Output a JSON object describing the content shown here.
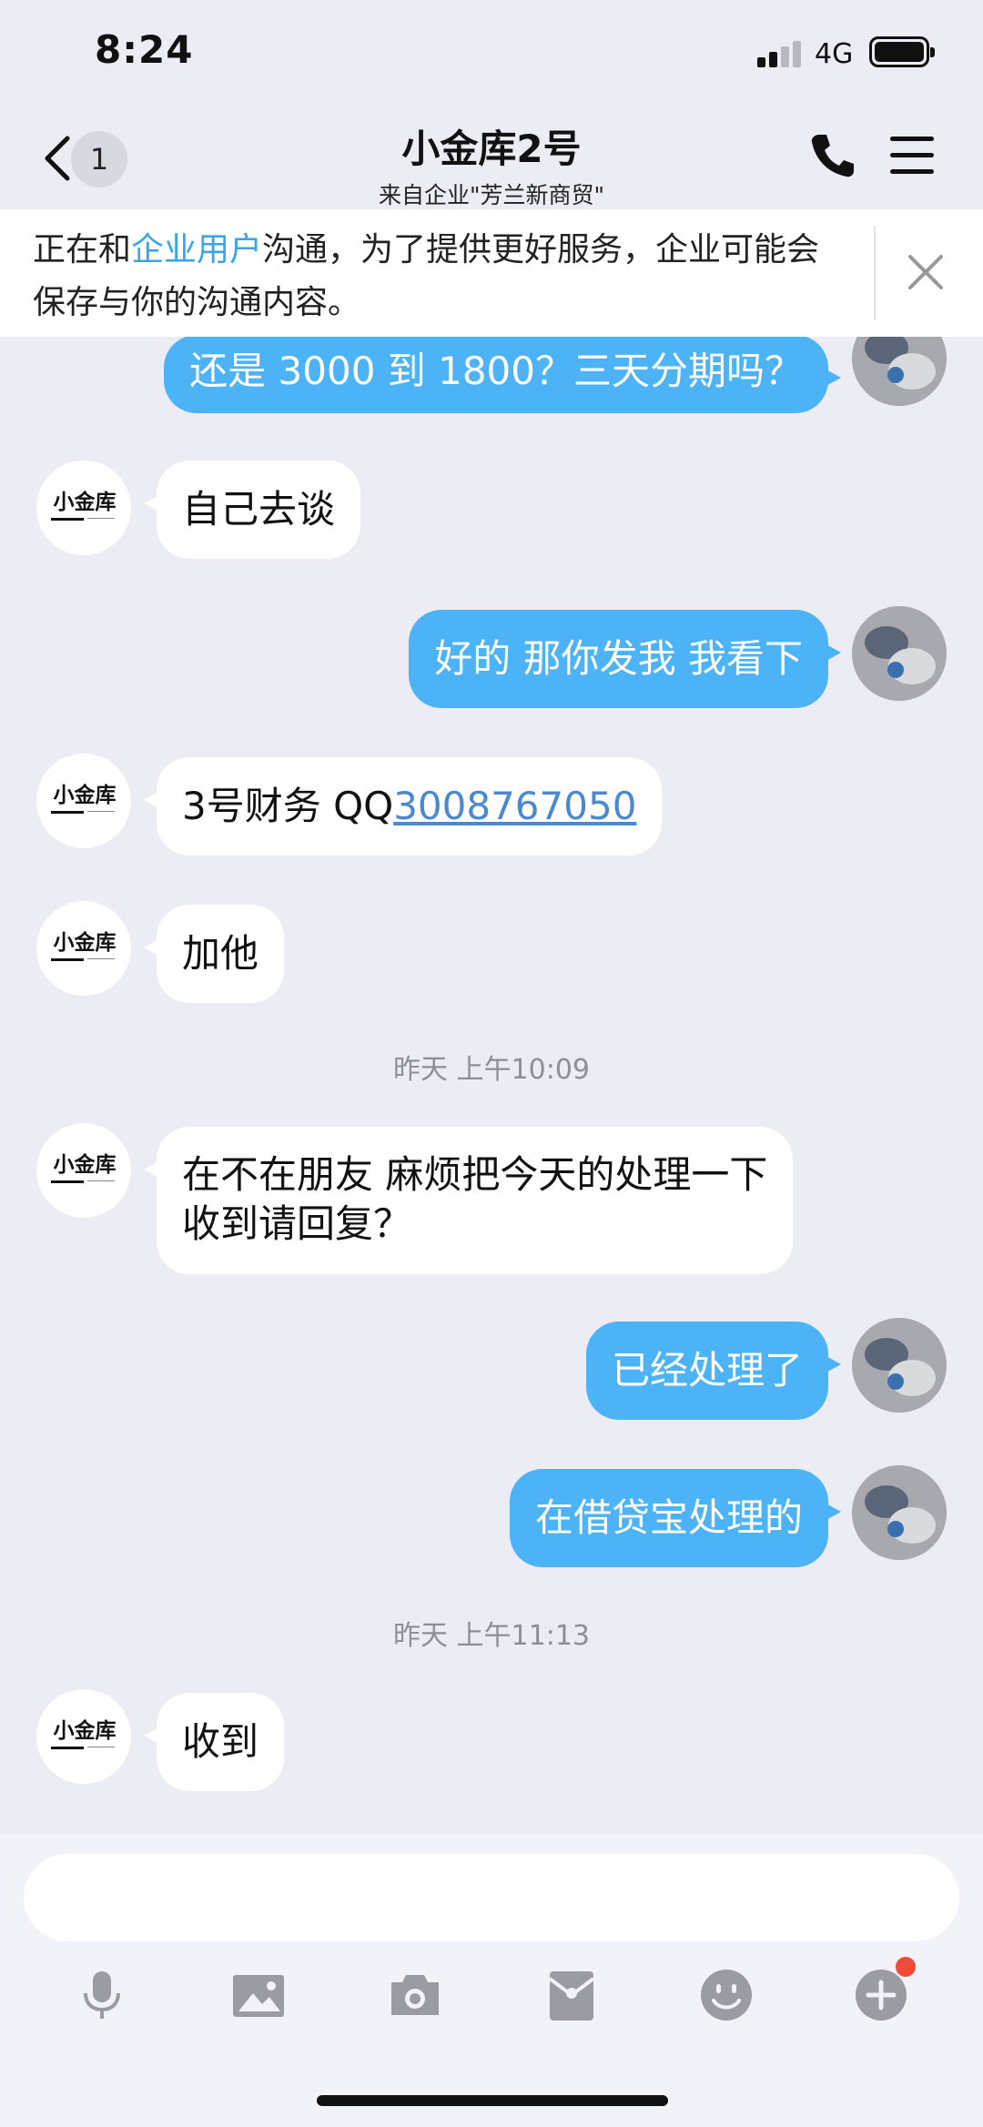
{
  "status_bar": {
    "time": "8:24",
    "network": "4G"
  },
  "nav": {
    "back_badge": "1",
    "title": "小金库2号",
    "subtitle": "来自企业\"芳兰新商贸\""
  },
  "notice": {
    "prefix": "正在和",
    "highlight": "企业用户",
    "suffix": "沟通，为了提供更好服务，企业可能会保存与你的沟通内容。"
  },
  "contact_avatar": {
    "logo_text": "小金库"
  },
  "messages": [
    {
      "side": "out",
      "text": "还是 3000 到 1800？三天分期吗？"
    },
    {
      "side": "in",
      "text": "自己去谈"
    },
    {
      "side": "out",
      "text": "好的 那你发我 我看下"
    },
    {
      "side": "in",
      "text_prefix": "3号财务 QQ",
      "link": "3008767050"
    },
    {
      "side": "in",
      "text": "加他"
    },
    {
      "side": "time",
      "text": "昨天 上午10:09"
    },
    {
      "side": "in",
      "line1": "在不在朋友  麻烦把今天的处理一下",
      "line2": "收到请回复？"
    },
    {
      "side": "out",
      "text": "已经处理了"
    },
    {
      "side": "out",
      "text": "在借贷宝处理的"
    },
    {
      "side": "time",
      "text": "昨天 上午11:13"
    },
    {
      "side": "in",
      "text": "收到"
    }
  ],
  "input": {
    "placeholder": ""
  },
  "toolbar": [
    "microphone-icon",
    "image-icon",
    "camera-icon",
    "red-packet-icon",
    "emoji-icon",
    "plus-icon"
  ],
  "colors": {
    "accent": "#4cb3f6",
    "highlight": "#3aa5e6",
    "badge_dot": "#f04a3a",
    "background": "#ebecf4"
  }
}
